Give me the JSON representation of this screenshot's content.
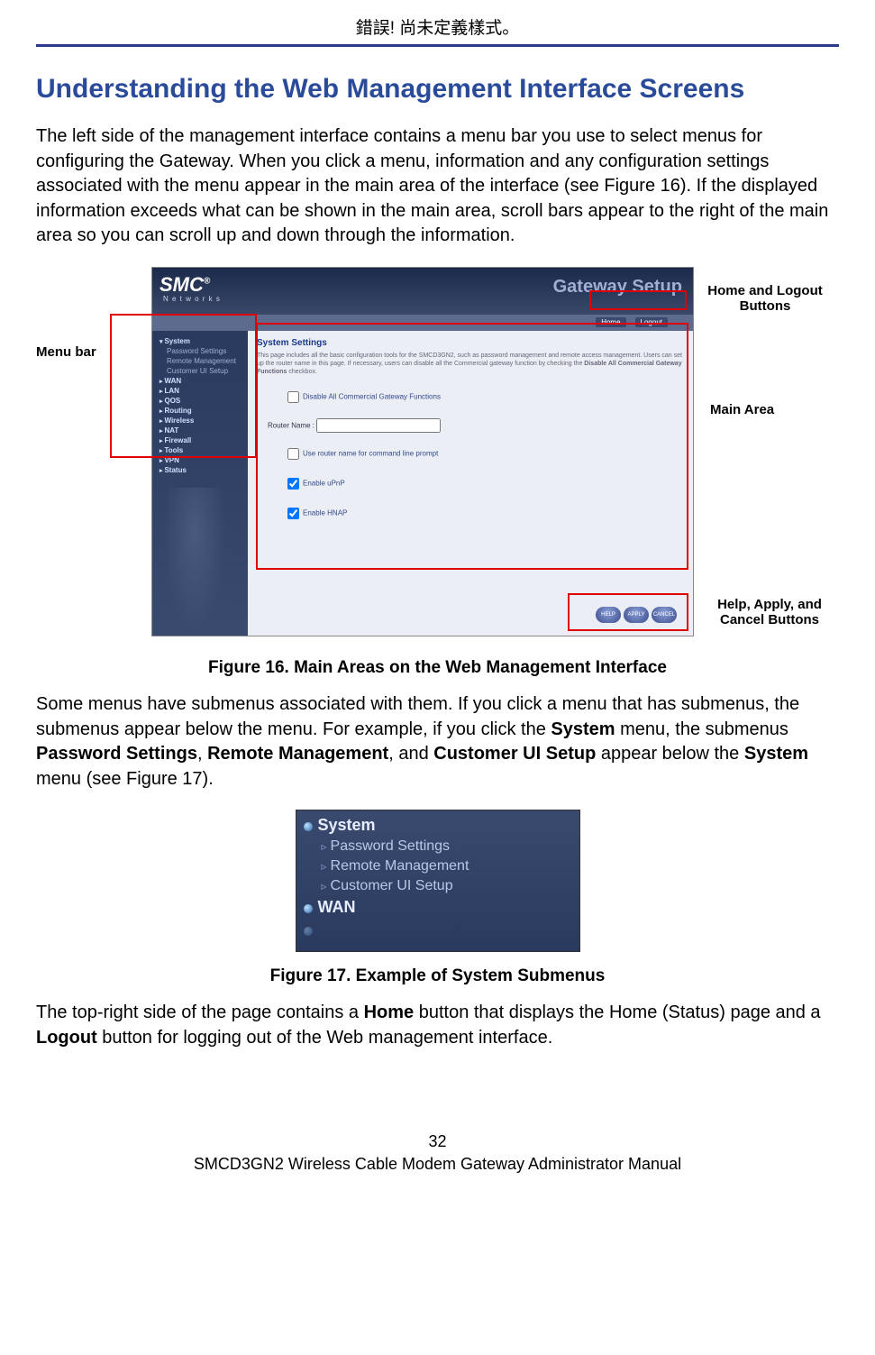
{
  "header_error": "錯誤! 尚未定義樣式。",
  "heading": "Understanding the Web Management Interface Screens",
  "para1": "The left side of the management interface contains a menu bar you use to select menus for configuring the Gateway. When you click a menu, information and any configuration settings associated with the menu appear in the main area of the interface (see Figure 16). If the displayed information exceeds what can be shown in the main area, scroll bars appear to the right of the main area so you can scroll up and down through the information.",
  "callouts": {
    "menu_bar": "Menu bar",
    "home_logout": "Home and Logout Buttons",
    "main_area": "Main Area",
    "help_apply": "Help, Apply, and Cancel Buttons"
  },
  "fig16": {
    "logo": "SMC",
    "logo_sub": "N e t w o r k s",
    "title": "Gateway Setup",
    "bar": {
      "home": "Home",
      "logout": "Logout"
    },
    "sidebar": {
      "system": "System",
      "password": "Password Settings",
      "remote": "Remote Management",
      "customer": "Customer UI Setup",
      "items": [
        "WAN",
        "LAN",
        "QOS",
        "Routing",
        "Wireless",
        "NAT",
        "Firewall",
        "Tools",
        "VPN",
        "Status"
      ]
    },
    "main": {
      "title": "System Settings",
      "desc_pre": "This page includes all the basic configuration tools for the SMCD3GN2, such as password management and remote access management. Users can set up the router name in this page. If necessary, users can disable all the Commercial gateway function by checking the ",
      "desc_bold": "Disable All Commercial Gateway Functions",
      "desc_post": " checkbox.",
      "ck1": "Disable All Commercial Gateway Functions",
      "router_name": "Router Name :",
      "ck2": "Use router name for command line prompt",
      "ck3": "Enable uPnP",
      "ck4": "Enable HNAP",
      "pills": {
        "help": "HELP",
        "apply": "APPLY",
        "cancel": "CANCEL"
      }
    }
  },
  "fig16_caption": "Figure 16. Main Areas on the Web Management Interface",
  "para2_pre": "Some menus have submenus associated with them. If you click a menu that has submenus, the submenus appear below the menu. For example, if you click the ",
  "para2_b1": "System",
  "para2_mid1": " menu, the submenus ",
  "para2_b2": "Password Settings",
  "para2_sep1": ", ",
  "para2_b3": "Remote Management",
  "para2_sep2": ", and ",
  "para2_b4": "Customer UI Setup",
  "para2_mid2": " appear below the ",
  "para2_b5": "System",
  "para2_post": " menu (see Figure 17).",
  "fig17": {
    "system": "System",
    "password": "Password Settings",
    "remote": "Remote Management",
    "customer": "Customer UI Setup",
    "wan": "WAN"
  },
  "fig17_caption": "Figure 17. Example of System Submenus",
  "para3_pre": "The top-right side of the page contains a ",
  "para3_b1": "Home",
  "para3_mid": " button that displays the Home (Status) page and a ",
  "para3_b2": "Logout",
  "para3_post": " button for logging out of the Web management interface.",
  "footer": {
    "page": "32",
    "title": "SMCD3GN2 Wireless Cable Modem Gateway Administrator Manual"
  }
}
